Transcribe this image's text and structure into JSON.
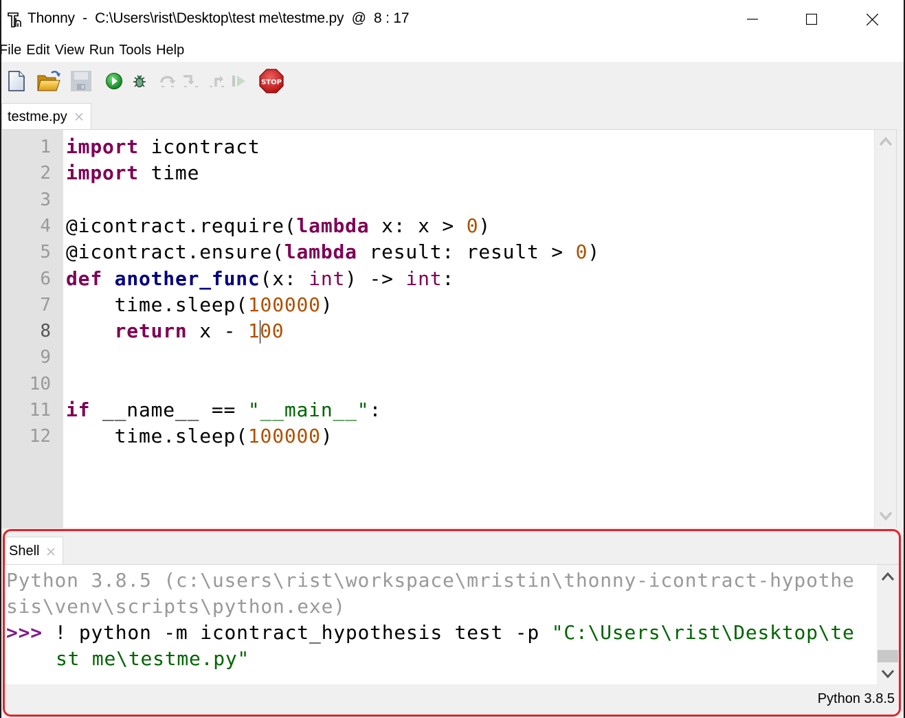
{
  "window": {
    "title": "Thonny  -  C:\\Users\\rist\\Desktop\\test me\\testme.py  @  8 : 17",
    "controls": [
      "minimize",
      "maximize",
      "close"
    ]
  },
  "menu": {
    "items": [
      "File",
      "Edit",
      "View",
      "Run",
      "Tools",
      "Help"
    ]
  },
  "toolbar": {
    "buttons": [
      {
        "name": "new-file",
        "icon": "new-file-icon",
        "enabled": true
      },
      {
        "name": "open-file",
        "icon": "open-folder-icon",
        "enabled": true
      },
      {
        "name": "save-file",
        "icon": "save-icon",
        "enabled": false
      },
      {
        "name": "run",
        "icon": "run-icon",
        "enabled": true
      },
      {
        "name": "debug",
        "icon": "bug-icon",
        "enabled": true
      },
      {
        "name": "step-over",
        "icon": "step-over-icon",
        "enabled": false
      },
      {
        "name": "step-into",
        "icon": "step-into-icon",
        "enabled": false
      },
      {
        "name": "step-out",
        "icon": "step-out-icon",
        "enabled": false
      },
      {
        "name": "resume",
        "icon": "resume-icon",
        "enabled": false
      },
      {
        "name": "stop",
        "icon": "stop-icon",
        "label": "STOP",
        "enabled": true
      }
    ]
  },
  "editor": {
    "tab": {
      "label": "testme.py",
      "close_icon": "close-icon"
    },
    "current_line": 8,
    "cursor": {
      "line": 8,
      "column": 17
    },
    "line_numbers": [
      "1",
      "2",
      "3",
      "4",
      "5",
      "6",
      "7",
      "8",
      "9",
      "10",
      "11",
      "12"
    ],
    "lines": [
      [
        {
          "t": "import",
          "c": "kw"
        },
        {
          "t": " icontract",
          "c": ""
        }
      ],
      [
        {
          "t": "import",
          "c": "kw"
        },
        {
          "t": " time",
          "c": ""
        }
      ],
      [],
      [
        {
          "t": "@icontract.require(",
          "c": ""
        },
        {
          "t": "lambda",
          "c": "kw"
        },
        {
          "t": " x: x > ",
          "c": ""
        },
        {
          "t": "0",
          "c": "num"
        },
        {
          "t": ")",
          "c": ""
        }
      ],
      [
        {
          "t": "@icontract.ensure(",
          "c": ""
        },
        {
          "t": "lambda",
          "c": "kw"
        },
        {
          "t": " result: result > ",
          "c": ""
        },
        {
          "t": "0",
          "c": "num"
        },
        {
          "t": ")",
          "c": ""
        }
      ],
      [
        {
          "t": "def",
          "c": "kw"
        },
        {
          "t": " ",
          "c": ""
        },
        {
          "t": "another_func",
          "c": "fn"
        },
        {
          "t": "(x: ",
          "c": ""
        },
        {
          "t": "int",
          "c": "builtin"
        },
        {
          "t": ") -> ",
          "c": ""
        },
        {
          "t": "int",
          "c": "builtin"
        },
        {
          "t": ":",
          "c": ""
        }
      ],
      [
        {
          "t": "    time.sleep(",
          "c": ""
        },
        {
          "t": "100000",
          "c": "num"
        },
        {
          "t": ")",
          "c": ""
        }
      ],
      [
        {
          "t": "    ",
          "c": ""
        },
        {
          "t": "return",
          "c": "kw"
        },
        {
          "t": " x - ",
          "c": ""
        },
        {
          "t": "1",
          "c": "num"
        },
        {
          "t": "|",
          "c": "caret"
        },
        {
          "t": "00",
          "c": "num"
        }
      ],
      [],
      [],
      [
        {
          "t": "if",
          "c": "kw"
        },
        {
          "t": " __name__ == ",
          "c": ""
        },
        {
          "t": "\"__main__\"",
          "c": "str"
        },
        {
          "t": ":",
          "c": ""
        }
      ],
      [
        {
          "t": "    time.sleep(",
          "c": ""
        },
        {
          "t": "100000",
          "c": "num"
        },
        {
          "t": ")",
          "c": ""
        }
      ]
    ]
  },
  "shell": {
    "tab": {
      "label": "Shell",
      "close_icon": "close-icon"
    },
    "banner_lines": [
      "Python 3.8.5 (c:\\users\\rist\\workspace\\mristin\\thonny-icontract-hypothe",
      "sis\\venv\\scripts\\python.exe)"
    ],
    "prompt": ">>>",
    "command_line1": {
      "plain": " ! python -m icontract_hypothesis test -p ",
      "string": "\"C:\\Users\\rist\\Desktop\\te"
    },
    "command_line2": {
      "string": "st me\\testme.py\""
    }
  },
  "statusbar": {
    "interpreter": "Python 3.8.5"
  },
  "colors": {
    "keyword": "#7f0055",
    "function_name": "#000080",
    "number": "#b05000",
    "string": "#006400",
    "prompt": "#7f1b8a",
    "highlight_border": "#e8202a"
  }
}
